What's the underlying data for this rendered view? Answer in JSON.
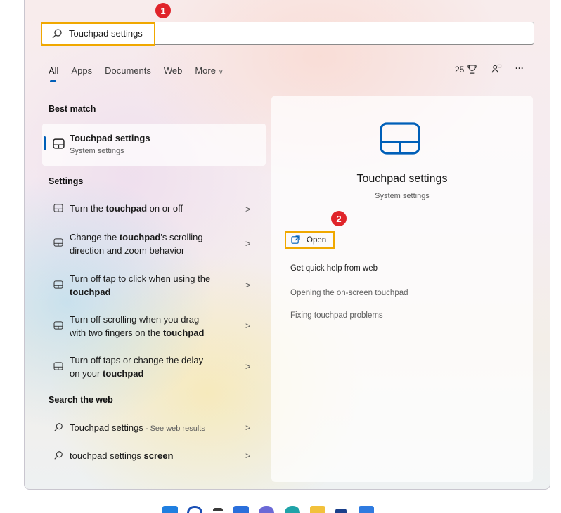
{
  "search": {
    "value": "Touchpad settings"
  },
  "badges": {
    "step1": "1",
    "step2": "2"
  },
  "tabs": [
    {
      "label": "All",
      "active": true
    },
    {
      "label": "Apps"
    },
    {
      "label": "Documents"
    },
    {
      "label": "Web"
    },
    {
      "label": "More",
      "suffix": "∨"
    }
  ],
  "top_right": {
    "points": "25",
    "trophy_icon": "trophy-icon",
    "people_icon": "people-icon",
    "more": "···"
  },
  "best_match": {
    "title": "Best match",
    "item": {
      "name": "Touchpad settings",
      "sub": "System settings"
    }
  },
  "settings": {
    "title": "Settings",
    "items": [
      {
        "pre": "Turn the ",
        "bold": "touchpad",
        "post": " on or off"
      },
      {
        "line1_pre": "Change the ",
        "line1_bold": "touchpad",
        "line1_post": "'s scrolling",
        "line2": "direction and zoom behavior"
      },
      {
        "line1": "Turn off tap to click when using the",
        "line2_bold": "touchpad"
      },
      {
        "line1": "Turn off scrolling when you drag",
        "line2_pre": "with two fingers on the ",
        "line2_bold": "touchpad"
      },
      {
        "line1": "Turn off taps or change the delay",
        "line2_pre": "on your ",
        "line2_bold": "touchpad"
      }
    ]
  },
  "web": {
    "title": "Search the web",
    "items": [
      {
        "text": "Touchpad settings",
        "suffix": " - See web results"
      },
      {
        "pre": "touchpad settings ",
        "bold": "screen"
      }
    ]
  },
  "chevron": ">",
  "right_pane": {
    "title": "Touchpad settings",
    "sub": "System settings",
    "open_label": "Open",
    "quick_help": "Get quick help from web",
    "links": [
      "Opening the on-screen touchpad",
      "Fixing touchpad problems"
    ]
  },
  "colors": {
    "accent": "#005fb8",
    "highlight": "#f0a800",
    "badge": "#e0242a"
  }
}
